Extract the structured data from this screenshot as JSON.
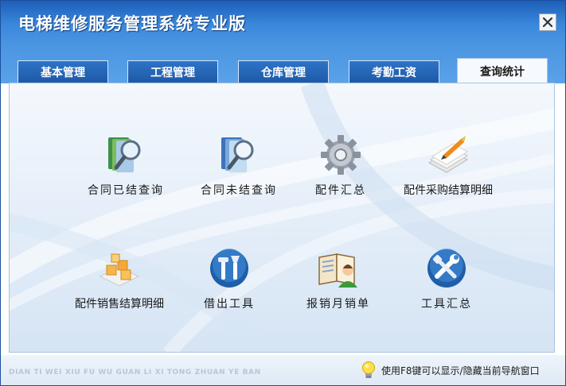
{
  "window": {
    "title": "电梯维修服务管理系统专业版",
    "close_symbol": "✕"
  },
  "tabs": [
    {
      "label": "基本管理",
      "active": false
    },
    {
      "label": "工程管理",
      "active": false
    },
    {
      "label": "仓库管理",
      "active": false
    },
    {
      "label": "考勤工资",
      "active": false
    },
    {
      "label": "查询统计",
      "active": true
    }
  ],
  "items": [
    {
      "label": "合同已结查询",
      "icon": "book-magnifier-icon"
    },
    {
      "label": "合同未结查询",
      "icon": "book-magnifier-icon"
    },
    {
      "label": "配件汇总",
      "icon": "gear-icon"
    },
    {
      "label": "配件采购结算明细",
      "icon": "documents-pen-icon"
    },
    {
      "label": "配件销售结算明细",
      "icon": "boxes-icon"
    },
    {
      "label": "借出工具",
      "icon": "tools-icon"
    },
    {
      "label": "报销月销单",
      "icon": "user-book-icon"
    },
    {
      "label": "工具汇总",
      "icon": "wrench-screwdriver-icon"
    }
  ],
  "footer": {
    "pinyin": "DIAN TI WEI XIU FU WU GUAN LI XI TONG ZHUAN YE BAN",
    "hint": "使用F8键可以显示/隐藏当前导航窗口",
    "hint_icon": "lightbulb-icon"
  },
  "colors": {
    "title_bar": "#2b6fc4",
    "tab_inactive": "#1d5aa8",
    "tab_active": "#f6f9fd",
    "panel_bg": "#e6eff9"
  }
}
